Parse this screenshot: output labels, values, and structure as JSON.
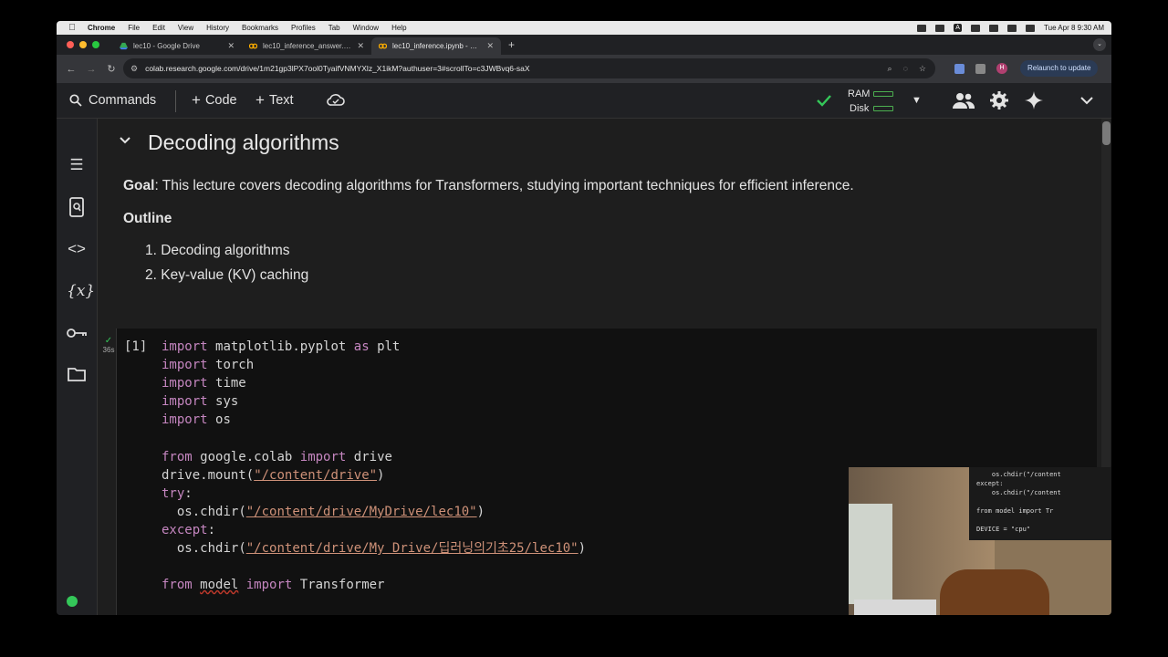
{
  "menubar": {
    "app": "Chrome",
    "items": [
      "File",
      "Edit",
      "View",
      "History",
      "Bookmarks",
      "Profiles",
      "Tab",
      "Window",
      "Help"
    ],
    "clock": "Tue Apr 8  9:30 AM"
  },
  "tabs": [
    {
      "title": "lec10 - Google Drive",
      "active": false
    },
    {
      "title": "lec10_inference_answer.ipynb",
      "active": false
    },
    {
      "title": "lec10_inference.ipynb - Colab",
      "active": true
    }
  ],
  "address": {
    "url": "colab.research.google.com/drive/1m21gp3lPX7ool0TyaifVNMYXlz_X1ikM?authuser=3#scrollTo=c3JWBvq6-saX",
    "relaunch": "Relaunch to update",
    "avatar": "H"
  },
  "toolbar": {
    "commands": "Commands",
    "code": "Code",
    "text": "Text",
    "ram": "RAM",
    "disk": "Disk"
  },
  "notebook": {
    "heading": "Decoding algorithms",
    "goal_label": "Goal",
    "goal_text": ": This lecture covers decoding algorithms for Transformers, studying important techniques for efficient inference.",
    "outline_label": "Outline",
    "outline": [
      "1. Decoding algorithms",
      "2. Key-value (KV) caching"
    ],
    "cell": {
      "prompt": "[1]",
      "exec_time": "36s",
      "lines": [
        "import matplotlib.pyplot as plt",
        "import torch",
        "import time",
        "import sys",
        "import os",
        "",
        "from google.colab import drive",
        "drive.mount(\"/content/drive\")",
        "try:",
        "  os.chdir(\"/content/drive/MyDrive/lec10\")",
        "except:",
        "  os.chdir(\"/content/drive/My Drive/딥러닝의기초25/lec10\")",
        "",
        "from model import Transformer",
        "",
        "DEVICE = \"cpu\""
      ]
    }
  },
  "webcam": {
    "lines": [
      "    os.chdir(\"/content",
      "except:",
      "    os.chdir(\"/content",
      "",
      "from model import Tr",
      "",
      "DEVICE = \"cpu\""
    ]
  },
  "colors": {
    "keyword": "#c586c0",
    "string": "#ce9178",
    "status_green": "#34c759"
  }
}
